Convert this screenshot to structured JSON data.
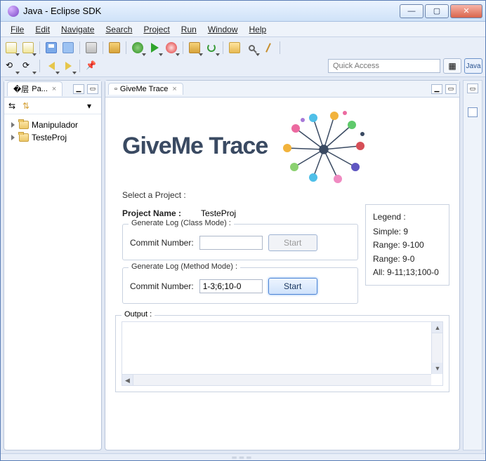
{
  "window": {
    "title": "Java - Eclipse SDK"
  },
  "menubar": [
    "File",
    "Edit",
    "Navigate",
    "Search",
    "Project",
    "Run",
    "Window",
    "Help"
  ],
  "quickaccess": {
    "placeholder": "Quick Access"
  },
  "perspective": {
    "label": "Java"
  },
  "packageExplorer": {
    "tabLabel": "Pa...",
    "projects": [
      "Manipulador",
      "TesteProj"
    ]
  },
  "editor": {
    "tabLabel": "GiveMe Trace",
    "logo": "GiveMe Trace",
    "selectLabel": "Select a Project :",
    "projectNameLabel": "Project Name   :",
    "projectName": "TesteProj",
    "classMode": {
      "legend": "Generate Log (Class Mode) :",
      "commitLabel": "Commit Number:",
      "commitValue": "",
      "startLabel": "Start"
    },
    "methodMode": {
      "legend": "Generate Log (Method Mode) :",
      "commitLabel": "Commit Number:",
      "commitValue": "1-3;6;10-0",
      "startLabel": "Start"
    },
    "legendBox": {
      "title": "Legend :",
      "lines": [
        "Simple: 9",
        "Range: 9-100",
        "Range: 9-0",
        "All: 9-11;13;100-0"
      ]
    },
    "output": {
      "legend": "Output :"
    }
  }
}
